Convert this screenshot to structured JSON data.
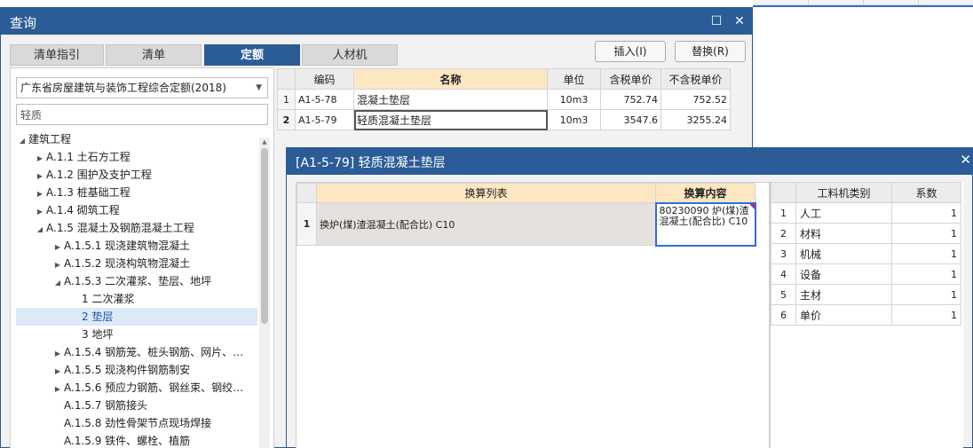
{
  "query_window": {
    "title": "查询",
    "controls": {
      "restore": "☐",
      "close": "✕"
    },
    "tabs": [
      {
        "label": "清单指引",
        "active": false
      },
      {
        "label": "清单",
        "active": false
      },
      {
        "label": "定额",
        "active": true
      },
      {
        "label": "人材机",
        "active": false
      }
    ],
    "insert_button": "插入(I)",
    "replace_button": "替换(R)",
    "quota_library": "广东省房屋建筑与装饰工程综合定额(2018)",
    "filter_value": "轻质",
    "tree": [
      {
        "label": "建筑工程",
        "expanded": true,
        "selected": false
      },
      {
        "label": "A.1.1 土石方工程",
        "expanded": false,
        "selected": false
      },
      {
        "label": "A.1.2 围护及支护工程",
        "expanded": false,
        "selected": false
      },
      {
        "label": "A.1.3 桩基础工程",
        "expanded": false,
        "selected": false
      },
      {
        "label": "A.1.4 砌筑工程",
        "expanded": false,
        "selected": false
      },
      {
        "label": "A.1.5 混凝土及钢筋混凝土工程",
        "expanded": true,
        "selected": false
      },
      {
        "label": "A.1.5.1 现浇建筑物混凝土",
        "expanded": false,
        "selected": false
      },
      {
        "label": "A.1.5.2 现浇构筑物混凝土",
        "expanded": false,
        "selected": false
      },
      {
        "label": "A.1.5.3 二次灌浆、垫层、地坪",
        "expanded": true,
        "selected": false
      },
      {
        "label": "1 二次灌浆",
        "expanded": null,
        "selected": false
      },
      {
        "label": "2 垫层",
        "expanded": null,
        "selected": true
      },
      {
        "label": "3 地坪",
        "expanded": null,
        "selected": false
      },
      {
        "label": "A.1.5.4 钢筋笼、桩头钢筋、网片、…",
        "expanded": false,
        "selected": false
      },
      {
        "label": "A.1.5.5 现浇构件钢筋制安",
        "expanded": false,
        "selected": false
      },
      {
        "label": "A.1.5.6 预应力钢筋、钢丝束、钢绞…",
        "expanded": false,
        "selected": false
      },
      {
        "label": "A.1.5.7 钢筋接头",
        "expanded": null,
        "selected": false
      },
      {
        "label": "A.1.5.8 劲性骨架节点现场焊接",
        "expanded": null,
        "selected": false
      },
      {
        "label": "A.1.5.9 铁件、螺栓、植筋",
        "expanded": null,
        "selected": false
      }
    ],
    "quota_grid": {
      "headers": [
        "编码",
        "名称",
        "单位",
        "含税单价",
        "不含税单价"
      ],
      "rows": [
        {
          "no": "1",
          "code": "A1-5-78",
          "name": "混凝土垫层",
          "unit": "10m3",
          "price_tax": "752.74",
          "price_notax": "752.52"
        },
        {
          "no": "2",
          "code": "A1-5-79",
          "name": "轻质混凝土垫层",
          "unit": "10m3",
          "price_tax": "3547.6",
          "price_notax": "3255.24"
        }
      ]
    }
  },
  "conversion_dialog": {
    "title": "[A1-5-79] 轻质混凝土垫层",
    "close": "✕",
    "headers": [
      "换算列表",
      "换算内容"
    ],
    "rows": [
      {
        "no": "1",
        "item": "换炉(煤)渣混凝土(配合比) C10",
        "content": "80230090  炉(煤)渣混凝土(配合比) C10"
      }
    ],
    "factor_headers": [
      "工料机类别",
      "系数"
    ],
    "factors": [
      {
        "no": "1",
        "category": "人工",
        "value": "1"
      },
      {
        "no": "2",
        "category": "材料",
        "value": "1"
      },
      {
        "no": "3",
        "category": "机械",
        "value": "1"
      },
      {
        "no": "4",
        "category": "设备",
        "value": "1"
      },
      {
        "no": "5",
        "category": "主材",
        "value": "1"
      },
      {
        "no": "6",
        "category": "单价",
        "value": "1"
      }
    ]
  },
  "colors": {
    "title_bar": "#2b5c97",
    "header_highlight": "#fde6c2",
    "selection": "#dce9f7",
    "content_border": "#2f6fd6"
  }
}
